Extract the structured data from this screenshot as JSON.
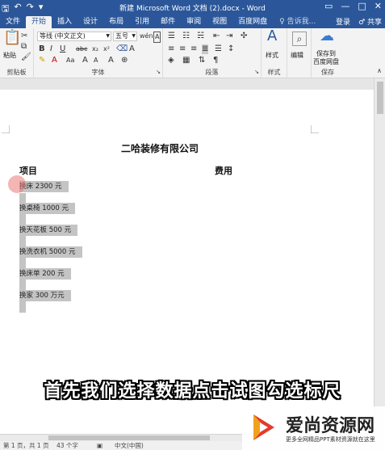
{
  "window": {
    "title": "新建 Microsoft Word 文档 (2).docx - Word",
    "qat": [
      "save-icon",
      "undo-icon",
      "redo-icon",
      "customize-icon"
    ],
    "buttons": {
      "restore": "▭",
      "minimize": "—",
      "maximize": "□",
      "close": "✕"
    }
  },
  "tabs": [
    "文件",
    "开始",
    "插入",
    "设计",
    "布局",
    "引用",
    "邮件",
    "审阅",
    "视图",
    "百度网盘"
  ],
  "active_tab": "开始",
  "search_placeholder": "♀ 告诉我...",
  "account": {
    "login": "登录",
    "share": "♂ 共享"
  },
  "ribbon": {
    "clipboard": {
      "label": "剪贴板",
      "paste": "粘贴"
    },
    "font": {
      "label": "字体",
      "name": "等线 (中文正文)",
      "size": "五号",
      "wen": "wén",
      "a_label": "A"
    },
    "paragraph": {
      "label": "段落"
    },
    "styles": {
      "label": "样式",
      "button": "样式"
    },
    "editing": {
      "button": "编辑"
    },
    "save": {
      "label": "保存",
      "button_line1": "保存到",
      "button_line2": "百度网盘"
    }
  },
  "document": {
    "title": "二哈装修有限公司",
    "headers": [
      "项目",
      "费用"
    ],
    "items": [
      "换床 2300 元",
      "换桌椅 1000 元",
      "换天花板 500 元",
      "换洗衣机 5000 元",
      "换床单 200 元",
      "换家 300 万元"
    ]
  },
  "subtitle": "首先我们选择数据点击试图勾选标尺",
  "status": {
    "page": "第 1 页，共 1 页",
    "words": "43 个字",
    "lang": "中文(中国)"
  },
  "watermark": {
    "brand": "爱尚资源网",
    "tagline": "更多全网精品PPT素材资源就在这里"
  },
  "colors": {
    "accent": "#2b579a",
    "selection": "#c4c4c4"
  }
}
